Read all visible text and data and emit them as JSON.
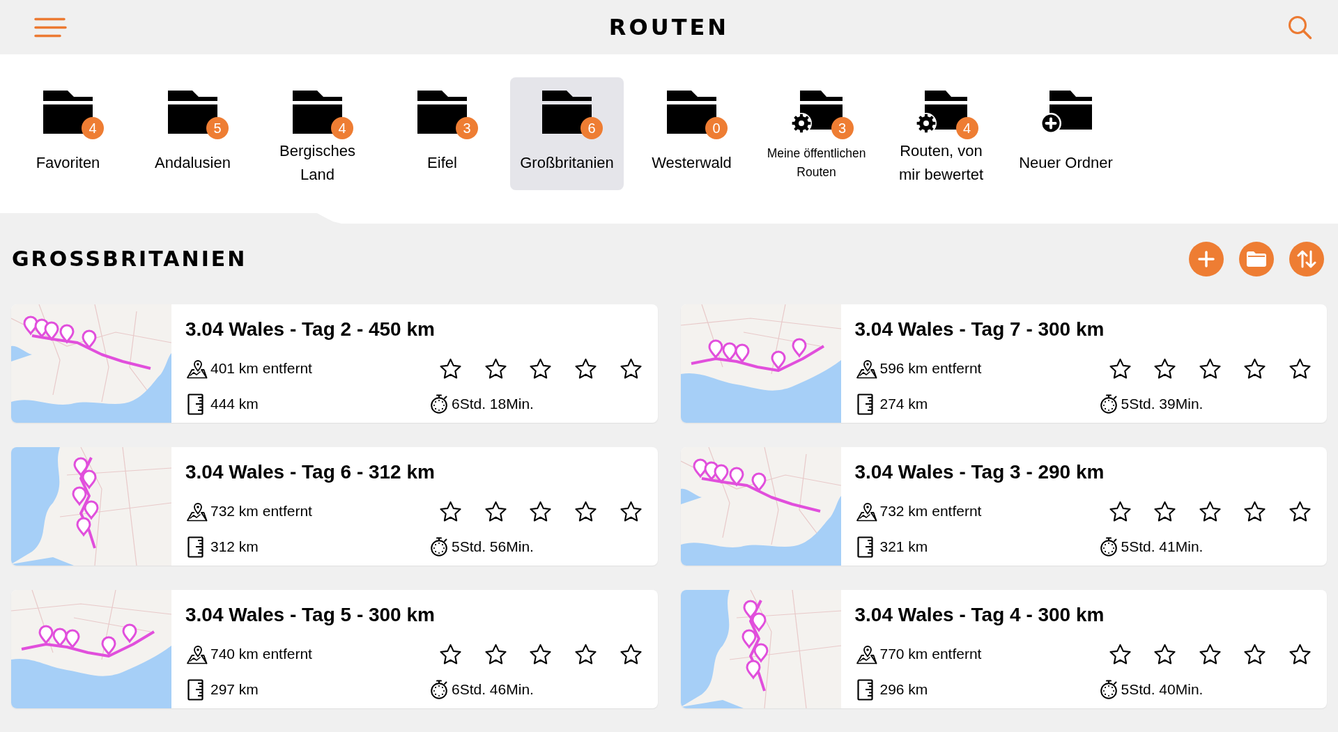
{
  "header": {
    "title": "ROUTEN"
  },
  "folders": [
    {
      "label": "Favoriten",
      "kind": "folder",
      "count": "4",
      "selected": false
    },
    {
      "label": "Andalusien",
      "kind": "folder",
      "count": "5",
      "selected": false
    },
    {
      "label": "Bergisches Land",
      "kind": "folder",
      "count": "4",
      "selected": false
    },
    {
      "label": "Eifel",
      "kind": "folder",
      "count": "3",
      "selected": false
    },
    {
      "label": "Großbritanien",
      "kind": "folder",
      "count": "6",
      "selected": true
    },
    {
      "label": "Westerwald",
      "kind": "folder",
      "count": "0",
      "selected": false
    },
    {
      "label": "Meine öffentlichen Routen",
      "kind": "shared",
      "count": "3",
      "selected": false
    },
    {
      "label": "Routen, von mir bewertet",
      "kind": "shared",
      "count": "4",
      "selected": false
    },
    {
      "label": "Neuer Ordner",
      "kind": "new",
      "selected": false
    }
  ],
  "section": {
    "title": "GROSSBRITANIEN",
    "actions": [
      {
        "kind": "add"
      },
      {
        "kind": "folder"
      },
      {
        "kind": "sort"
      }
    ]
  },
  "routes": [
    {
      "title": "3.04 Wales - Tag 2 - 450 km",
      "distance_away": "401 km entfernt",
      "length": "444 km",
      "duration": "6Std. 18Min.",
      "stars": 0
    },
    {
      "title": "3.04 Wales - Tag 7 - 300 km",
      "distance_away": "596 km entfernt",
      "length": "274 km",
      "duration": "5Std. 39Min.",
      "stars": 0
    },
    {
      "title": "3.04 Wales - Tag 6 - 312 km",
      "distance_away": "732 km entfernt",
      "length": "312 km",
      "duration": "5Std. 56Min.",
      "stars": 0
    },
    {
      "title": "3.04 Wales - Tag 3 - 290 km",
      "distance_away": "732 km entfernt",
      "length": "321 km",
      "duration": "5Std. 41Min.",
      "stars": 0
    },
    {
      "title": "3.04 Wales - Tag 5 - 300 km",
      "distance_away": "740 km entfernt",
      "length": "297 km",
      "duration": "6Std. 46Min.",
      "stars": 0
    },
    {
      "title": "3.04 Wales - Tag 4 - 300 km",
      "distance_away": "770 km entfernt",
      "length": "296 km",
      "duration": "5Std. 40Min.",
      "stars": 0
    }
  ]
}
